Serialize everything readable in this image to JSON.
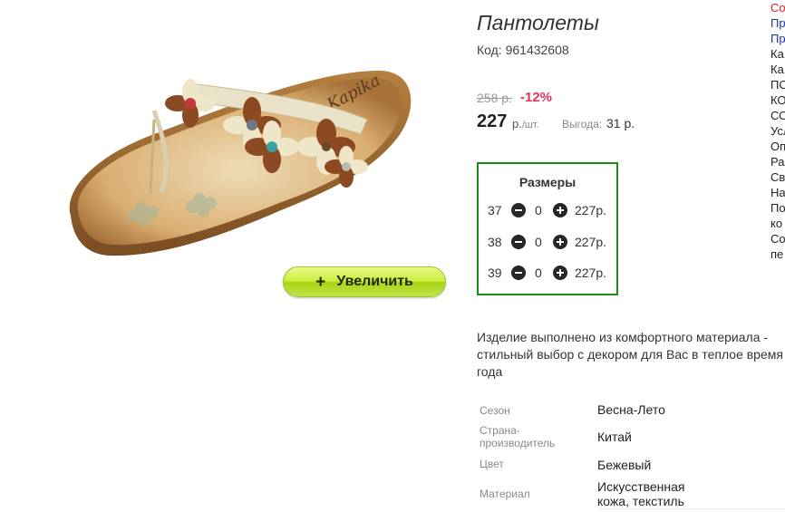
{
  "product": {
    "title": "Пантолеты",
    "code": "Код: 961432608",
    "old_price": "258 р.",
    "discount": "-12%",
    "price": "227",
    "price_unit": "р.",
    "price_per": "/шт.",
    "savings_label": "Выгода:",
    "savings_value": "31 р.",
    "zoom_label": "Увеличить",
    "zoom_icon": "plus-icon",
    "image_brand": "Kapika"
  },
  "sizes": {
    "title": "Размеры",
    "rows": [
      {
        "size": "37",
        "qty": "0",
        "price": "227р."
      },
      {
        "size": "38",
        "qty": "0",
        "price": "227р."
      },
      {
        "size": "39",
        "qty": "0",
        "price": "227р."
      }
    ]
  },
  "description": "Изделие выполнено из комфортного материала - стильный выбор с декором для Вас в теплое время года",
  "specs": [
    {
      "label": "Сезон",
      "value": "Весна-Лето"
    },
    {
      "label": "Страна-производитель",
      "value": "Китай"
    },
    {
      "label": "Цвет",
      "value": "Бежевый"
    },
    {
      "label": "Материал",
      "value": "Искусственная кожа, текстиль"
    }
  ],
  "side_menu": [
    {
      "text": "Со",
      "color": "red"
    },
    {
      "text": "Пр",
      "color": "blue"
    },
    {
      "text": "Пр",
      "color": "blue"
    },
    {
      "text": "Ка",
      "color": "dark"
    },
    {
      "text": "Ка",
      "color": "dark"
    },
    {
      "text": "ПО",
      "color": "dark"
    },
    {
      "text": "КО",
      "color": "dark"
    },
    {
      "text": "СО",
      "color": "dark"
    },
    {
      "text": "Усл",
      "color": "dark"
    },
    {
      "text": "Оп",
      "color": "dark"
    },
    {
      "text": "Ра",
      "color": "dark"
    },
    {
      "text": "Св",
      "color": "dark"
    },
    {
      "text": "На",
      "color": "dark"
    },
    {
      "text": "По",
      "color": "dark"
    },
    {
      "text": "ко",
      "color": "dark"
    },
    {
      "text": "Со",
      "color": "dark"
    },
    {
      "text": "пе",
      "color": "dark"
    }
  ],
  "colors": {
    "discount": "#e8305a",
    "sizes_border": "#1e8a1e",
    "zoom_button": "#c8ec3a",
    "menu_red": "#d62020",
    "menu_blue": "#1b2fb8"
  }
}
